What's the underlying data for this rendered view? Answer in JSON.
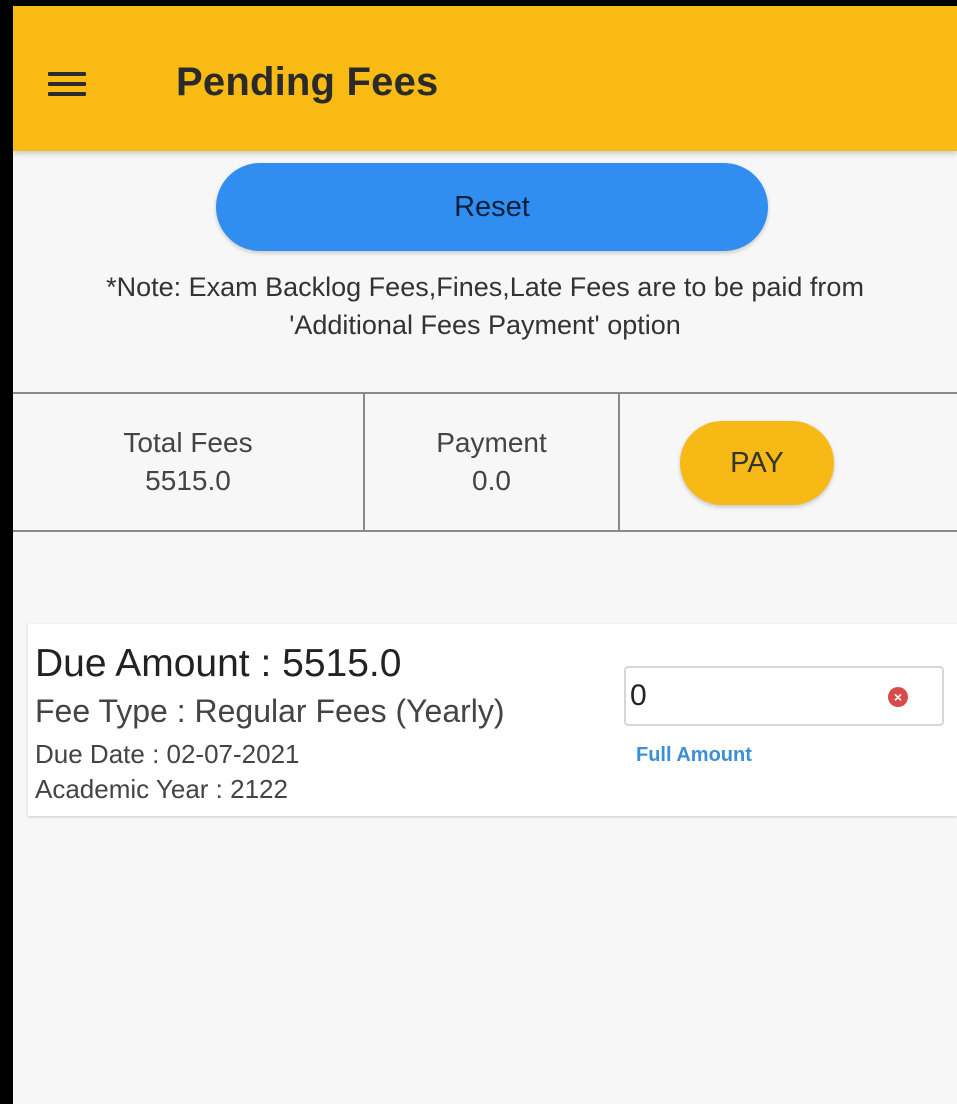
{
  "header": {
    "title": "Pending Fees",
    "menu_icon": "hamburger-menu-icon"
  },
  "actions": {
    "reset_label": "Reset",
    "pay_label": "PAY"
  },
  "note": {
    "line1": "*Note: Exam Backlog Fees,Fines,Late Fees are to be paid from",
    "line2": "'Additional Fees Payment' option"
  },
  "summary": {
    "total_label": "Total Fees",
    "total_value": "5515.0",
    "payment_label": "Payment",
    "payment_value": "0.0"
  },
  "fee_item": {
    "due_amount": "Due Amount : 5515.0",
    "fee_type": "Fee Type : Regular Fees (Yearly)",
    "due_date": "Due Date : 02-07-2021",
    "academic_year": "Academic Year : 2122",
    "amount_value": "0",
    "full_amount_label": "Full Amount",
    "clear_icon": "clear-circle-icon"
  },
  "colors": {
    "appbar": "#f9bb13",
    "reset_button": "#2f8ef0",
    "pay_button": "#f6b915",
    "link": "#3a8fd6",
    "clear_icon": "#d94b4b"
  }
}
